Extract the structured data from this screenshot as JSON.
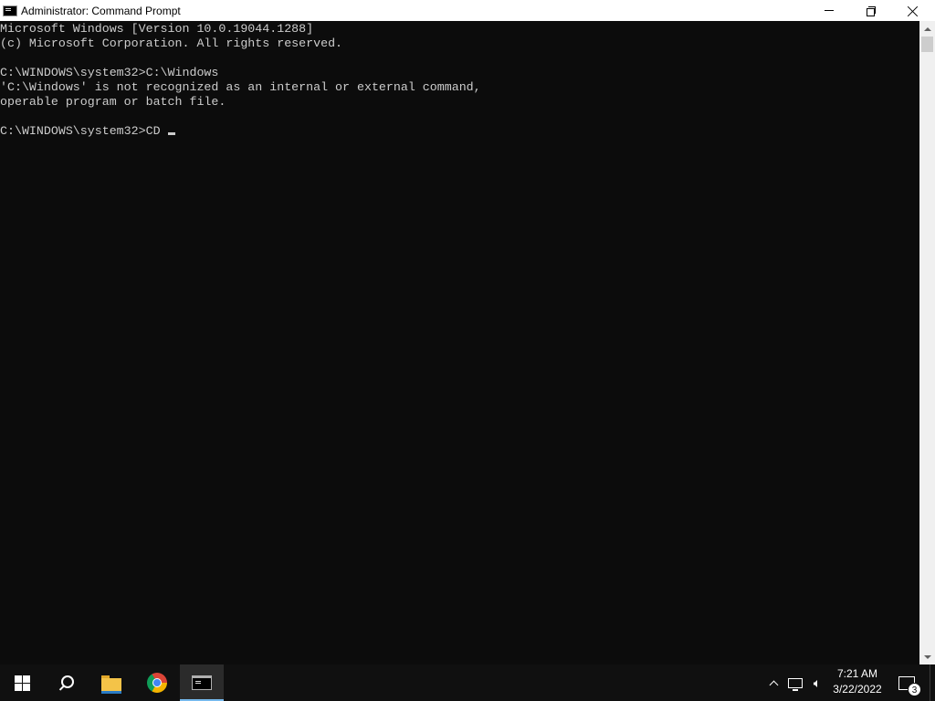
{
  "window": {
    "title": "Administrator: Command Prompt",
    "icon": "cmd-icon"
  },
  "console": {
    "lines": [
      "Microsoft Windows [Version 10.0.19044.1288]",
      "(c) Microsoft Corporation. All rights reserved.",
      "",
      "C:\\WINDOWS\\system32>C:\\Windows",
      "'C:\\Windows' is not recognized as an internal or external command,",
      "operable program or batch file.",
      "",
      "C:\\WINDOWS\\system32>CD "
    ],
    "text_color": "#cccccc",
    "background": "#0c0c0c"
  },
  "taskbar": {
    "apps": [
      "start-icon",
      "search-icon",
      "file-explorer-icon",
      "chrome-icon",
      "command-prompt-icon"
    ],
    "active_app": "command-prompt-icon",
    "accent": "#76b9ed",
    "clock": {
      "time": "7:21 AM",
      "date": "3/22/2022"
    },
    "notifications_count": "3"
  }
}
